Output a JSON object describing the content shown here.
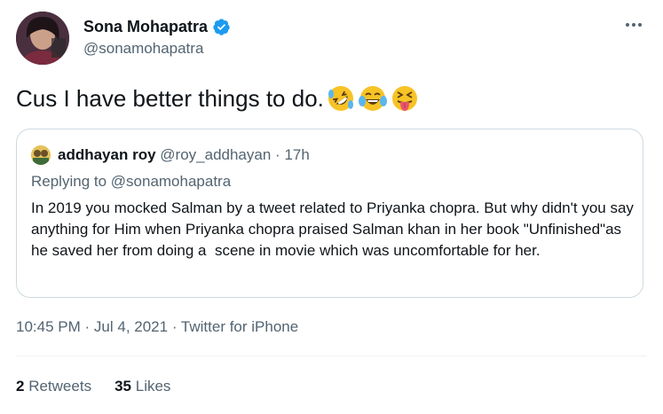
{
  "author": {
    "name": "Sona Mohapatra",
    "handle": "@sonamohapatra",
    "verified_color": "#1d9bf0"
  },
  "tweet": {
    "text": "Cus I have better things to do.",
    "emojis": [
      "rolling-on-floor-laughing",
      "tears-of-joy",
      "squinting-tongue"
    ]
  },
  "quoted": {
    "name": "addhayan roy",
    "handle": "@roy_addhayan",
    "separator": "·",
    "time": "17h",
    "replying_to": "Replying to @sonamohapatra",
    "text": "In 2019 you mocked Salman by a tweet related to Priyanka chopra. But why didn't you say anything for Him when Priyanka chopra praised Salman khan in her book \"Unfinished\"as he saved her from doing a  scene in movie which was uncomfortable for her."
  },
  "meta": {
    "time": "10:45 PM",
    "sep1": "·",
    "date": "Jul 4, 2021",
    "sep2": "·",
    "source": "Twitter for iPhone"
  },
  "stats": {
    "retweets_count": "2",
    "retweets_label": "Retweets",
    "likes_count": "35",
    "likes_label": "Likes"
  },
  "icons": {
    "more": "more-horizontal-icon",
    "verified": "verified-badge-icon"
  },
  "colors": {
    "text_primary": "#0f1419",
    "text_secondary": "#536471",
    "border": "#cfd9de",
    "accent": "#1d9bf0"
  }
}
